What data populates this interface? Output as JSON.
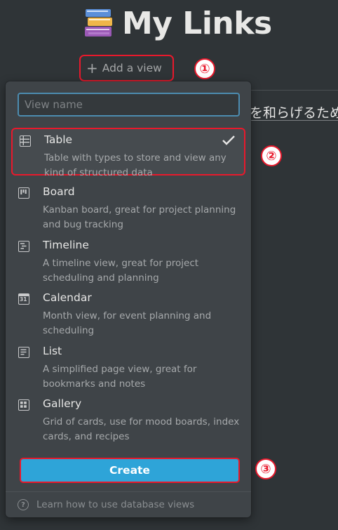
{
  "page": {
    "title": "My Links",
    "icon": "books-emoji-icon"
  },
  "toolbar": {
    "add_view_label": "Add a view"
  },
  "background": {
    "partial_text": "を和らげるため"
  },
  "annotations": {
    "step1": "①",
    "step2": "②",
    "step3": "③"
  },
  "popup": {
    "input": {
      "value": "",
      "placeholder": "View name"
    },
    "views": [
      {
        "label": "Table",
        "description": "Table with types to store and view any kind of structured data",
        "icon": "table-icon",
        "selected": true
      },
      {
        "label": "Board",
        "description": "Kanban board, great for project planning and bug tracking",
        "icon": "board-icon",
        "selected": false
      },
      {
        "label": "Timeline",
        "description": "A timeline view, great for project scheduling and planning",
        "icon": "timeline-icon",
        "selected": false
      },
      {
        "label": "Calendar",
        "description": "Month view, for event planning and scheduling",
        "icon": "calendar-icon",
        "selected": false
      },
      {
        "label": "List",
        "description": "A simplified page view, great for bookmarks and notes",
        "icon": "list-icon",
        "selected": false
      },
      {
        "label": "Gallery",
        "description": "Grid of cards, use for mood boards, index cards, and recipes",
        "icon": "gallery-icon",
        "selected": false
      }
    ],
    "create_label": "Create",
    "footer_help": "Learn how to use database views"
  },
  "colors": {
    "accent": "#2ea4d8",
    "annotation": "#e8192c",
    "background": "#2f3437",
    "popup": "#3f4448"
  }
}
